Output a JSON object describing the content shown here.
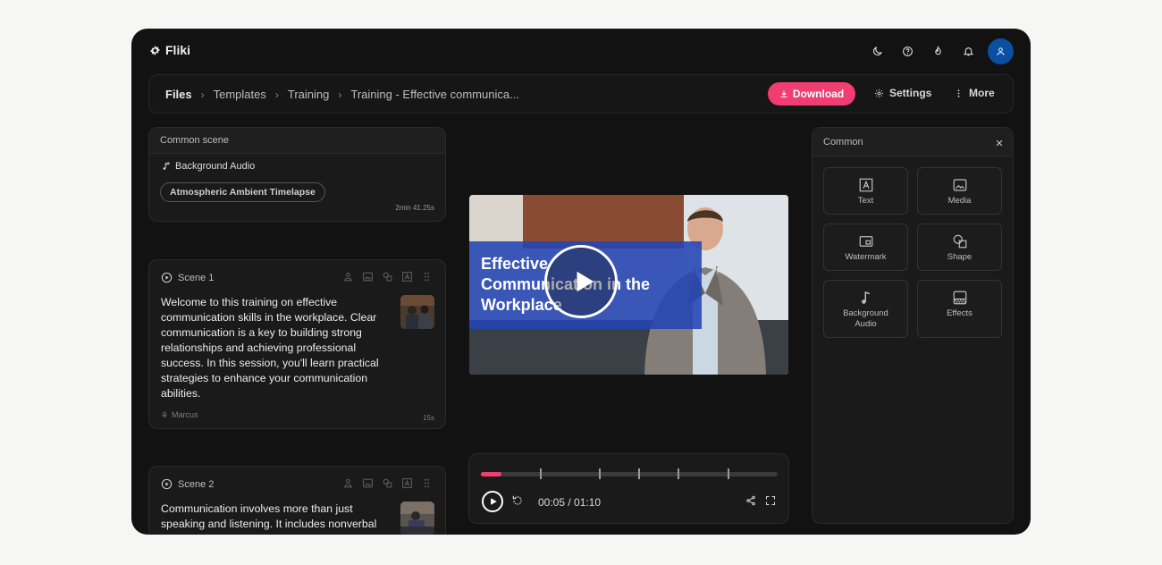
{
  "app": {
    "name": "Fliki"
  },
  "topbar": {
    "icons": [
      "moon-icon",
      "help-icon",
      "fire-icon",
      "bell-icon",
      "user-icon"
    ]
  },
  "breadcrumb": [
    "Files",
    "Templates",
    "Training",
    "Training - Effective communica..."
  ],
  "toolbar": {
    "download_label": "Download",
    "settings_label": "Settings",
    "more_label": "More"
  },
  "common_scene": {
    "header": "Common scene",
    "audio_label": "Background Audio",
    "audio_track": "Atmospheric Ambient Timelapse",
    "duration": "2min 41.25s"
  },
  "scenes": [
    {
      "title": "Scene 1",
      "text": "Welcome to this training on effective communication skills in the workplace. Clear communication is a key to building strong relationships and achieving professional success. In this session, you'll learn practical strategies to enhance your communication abilities.",
      "voice": "Marcus",
      "duration": "15s"
    },
    {
      "title": "Scene 2",
      "text": "Communication involves more than just speaking and listening. It includes nonverbal"
    }
  ],
  "video": {
    "title": "Effective Communication in the Workplace"
  },
  "player": {
    "time": "00:05 / 01:10",
    "progress": 0.07
  },
  "right_panel": {
    "header": "Common",
    "tiles": [
      "Text",
      "Media",
      "Watermark",
      "Shape",
      "Background Audio",
      "Effects"
    ]
  },
  "colors": {
    "accent": "#f23d72",
    "avatar": "#0b4fa3",
    "band": "#2344b4"
  }
}
